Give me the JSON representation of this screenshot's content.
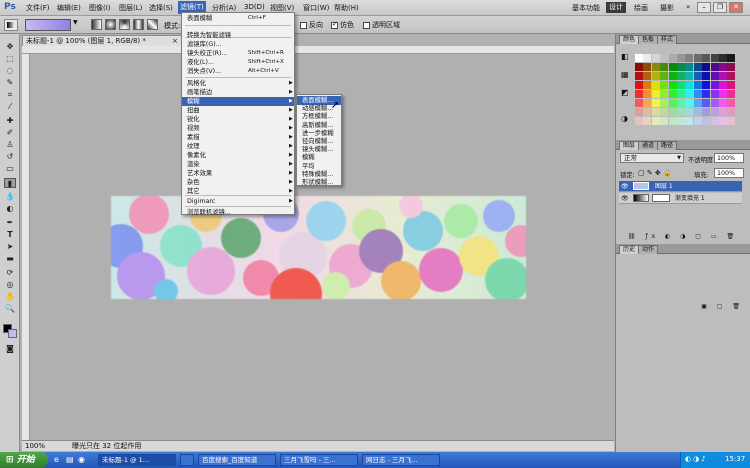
{
  "app": {
    "logo": "Ps"
  },
  "menubar": {
    "items": [
      "文件(F)",
      "编辑(E)",
      "图像(I)",
      "图层(L)",
      "选择(S)",
      "滤镜(T)",
      "分析(A)",
      "3D(D)",
      "视图(V)",
      "窗口(W)",
      "帮助(H)"
    ],
    "active": "滤镜(T)",
    "workspaces": [
      "基本功能",
      "设计",
      "绘画",
      "摄影"
    ],
    "workspace_selected": "设计",
    "overflow": "»"
  },
  "options": {
    "mode_label": "模式:",
    "checkboxes": [
      {
        "label": "反向",
        "checked": false
      },
      {
        "label": "仿色",
        "checked": true
      },
      {
        "label": "透明区域",
        "checked": false
      }
    ]
  },
  "document": {
    "tab_title": "未标题-1 @ 100% (图层 1, RGB/8) *",
    "zoom": "100%",
    "status": "曝光只在 32 位起作用"
  },
  "filter_menu": {
    "items": [
      {
        "label": "表面模糊",
        "shortcut": "Ctrl+F"
      },
      {
        "label": "转换为智能滤镜"
      },
      {
        "label": "滤镜库(G)..."
      },
      {
        "label": "镜头校正(R)...",
        "shortcut": "Shift+Ctrl+R"
      },
      {
        "label": "液化(L)...",
        "shortcut": "Shift+Ctrl+X"
      },
      {
        "label": "消失点(V)...",
        "shortcut": "Alt+Ctrl+V"
      },
      {
        "label": "风格化",
        "submenu": true
      },
      {
        "label": "画笔描边",
        "submenu": true
      },
      {
        "label": "模糊",
        "submenu": true,
        "highlighted": true
      },
      {
        "label": "扭曲",
        "submenu": true
      },
      {
        "label": "锐化",
        "submenu": true
      },
      {
        "label": "视频",
        "submenu": true
      },
      {
        "label": "素描",
        "submenu": true
      },
      {
        "label": "纹理",
        "submenu": true
      },
      {
        "label": "像素化",
        "submenu": true
      },
      {
        "label": "渲染",
        "submenu": true
      },
      {
        "label": "艺术效果",
        "submenu": true
      },
      {
        "label": "杂色",
        "submenu": true
      },
      {
        "label": "其它",
        "submenu": true
      },
      {
        "label": "Digimarc",
        "submenu": true
      },
      {
        "label": "浏览联机滤镜..."
      }
    ]
  },
  "blur_submenu": {
    "items": [
      "表面模糊...",
      "动感模糊...",
      "方框模糊...",
      "高斯模糊...",
      "进一步模糊",
      "径向模糊...",
      "镜头模糊...",
      "模糊",
      "平均",
      "特殊模糊...",
      "形状模糊..."
    ],
    "highlighted": "表面模糊..."
  },
  "panels": {
    "color": {
      "tabs": [
        "颜色",
        "色板",
        "样式"
      ]
    },
    "layers": {
      "tabs": [
        "图层",
        "通道",
        "路径"
      ],
      "blend_mode": "正常",
      "opacity_label": "不透明度:",
      "opacity": "100%",
      "lock_label": "锁定:",
      "fill_label": "填充:",
      "fill": "100%",
      "layers": [
        {
          "name": "图层 1",
          "selected": true
        },
        {
          "name": "渐变填充 1",
          "selected": false
        }
      ]
    },
    "history": {
      "tabs": [
        "历史",
        "动作"
      ]
    }
  },
  "taskbar": {
    "start": "开始",
    "tasks": [
      {
        "label": "未标题-1 @ 1...",
        "active": true
      },
      {
        "label": ""
      },
      {
        "label": "百度搜索_百度知道"
      },
      {
        "label": "三月飞雪吗 - 三..."
      },
      {
        "label": "网日志 - 三月飞..."
      }
    ],
    "clock": "15:37"
  },
  "colors": {
    "menu_highlight": "#3a64b3",
    "workspace_selected_bg": "#3b3b3b",
    "taskbar": "#2356b8",
    "start_button": "#3a8f36"
  }
}
